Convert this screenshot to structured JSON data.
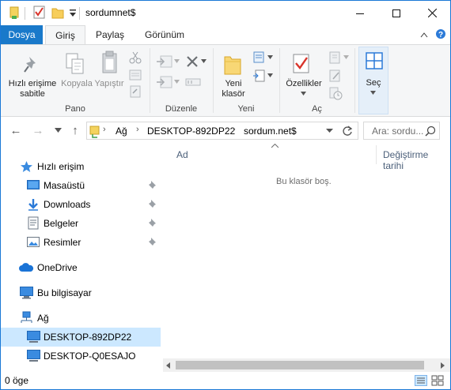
{
  "window": {
    "title": "sordumnet$",
    "controls": {
      "minimize": "minimize-icon",
      "maximize": "maximize-icon",
      "close": "close-icon"
    }
  },
  "tabs": [
    {
      "label": "Dosya"
    },
    {
      "label": "Giriş"
    },
    {
      "label": "Paylaş"
    },
    {
      "label": "Görünüm"
    }
  ],
  "ribbon": {
    "pano": {
      "label": "Pano",
      "quick_access_line1": "Hızlı erişime",
      "quick_access_line2": "sabitle",
      "copy": "Kopyala",
      "paste": "Yapıştır"
    },
    "duzenle": {
      "label": "Düzenle"
    },
    "yeni": {
      "label": "Yeni",
      "new_folder_line1": "Yeni",
      "new_folder_line2": "klasör"
    },
    "ac": {
      "label": "Aç",
      "properties": "Özellikler"
    },
    "sec": {
      "label": "Seç"
    }
  },
  "address": {
    "crumbs": [
      "Ağ",
      "DESKTOP-892DP22",
      "sordum.net$"
    ],
    "search_placeholder": "Ara: sordu..."
  },
  "nav": {
    "items": [
      {
        "label": "Hızlı erişim",
        "icon": "star-icon"
      },
      {
        "label": "Masaüstü",
        "icon": "desktop-icon",
        "pinned": true
      },
      {
        "label": "Downloads",
        "icon": "download-icon",
        "pinned": true
      },
      {
        "label": "Belgeler",
        "icon": "documents-icon",
        "pinned": true
      },
      {
        "label": "Resimler",
        "icon": "pictures-icon",
        "pinned": true
      },
      {
        "label": "OneDrive",
        "icon": "cloud-icon"
      },
      {
        "label": "Bu bilgisayar",
        "icon": "computer-icon"
      },
      {
        "label": "Ağ",
        "icon": "network-icon"
      },
      {
        "label": "DESKTOP-892DP22",
        "icon": "monitor-icon",
        "selected": true
      },
      {
        "label": "DESKTOP-Q0ESAJO",
        "icon": "monitor-icon"
      }
    ]
  },
  "content": {
    "columns": [
      "Ad",
      "Değiştirme tarihi"
    ],
    "empty_message": "Bu klasör boş."
  },
  "status": {
    "item_count": "0 öge"
  },
  "colors": {
    "accent": "#1979ca",
    "selected": "#cce8ff",
    "header_text": "#4c607a"
  }
}
